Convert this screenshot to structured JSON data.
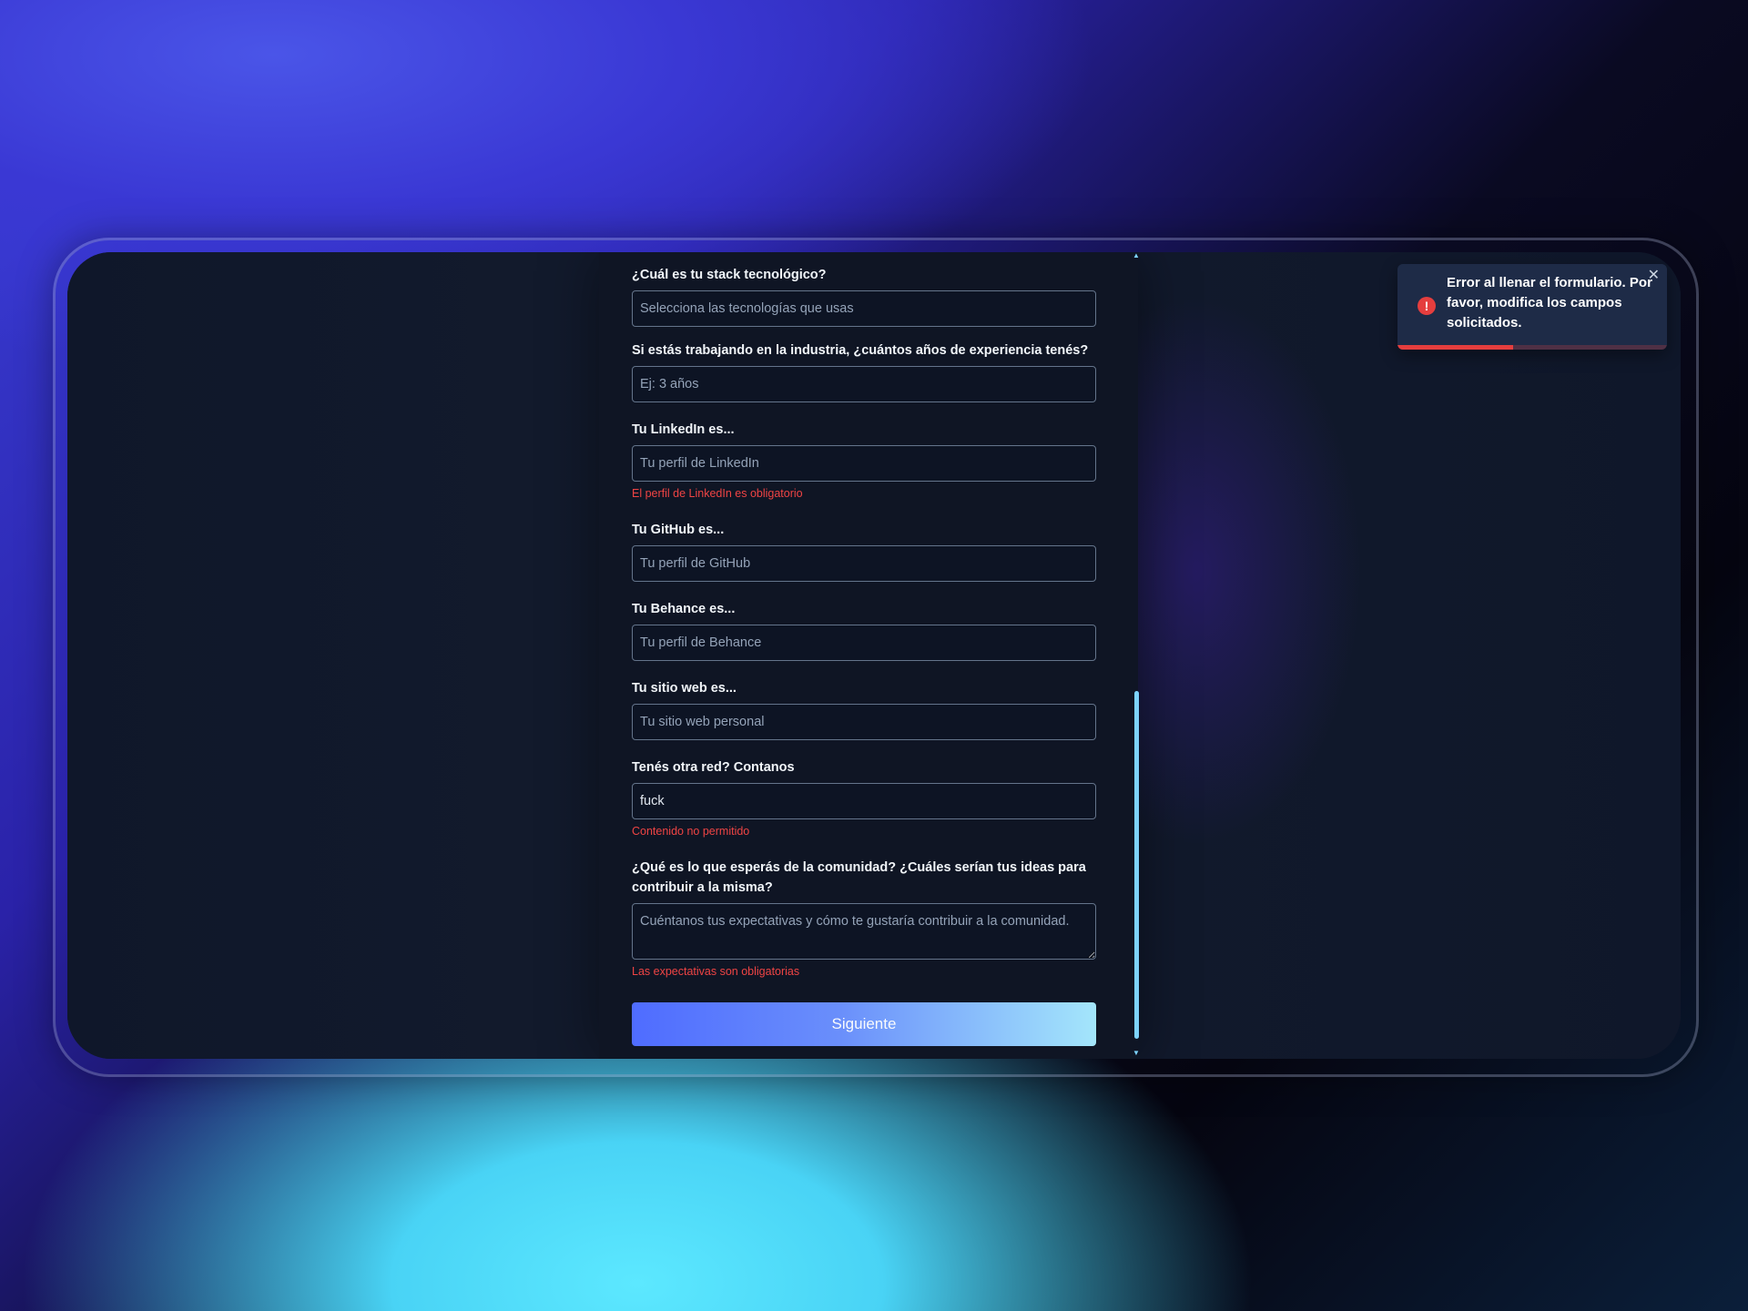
{
  "form": {
    "stack": {
      "label": "¿Cuál es tu stack tecnológico?",
      "placeholder": "Selecciona las tecnologías que usas"
    },
    "experience": {
      "label": "Si estás trabajando en la industria, ¿cuántos años de experiencia tenés?",
      "placeholder": "Ej: 3 años"
    },
    "linkedin": {
      "label": "Tu LinkedIn es...",
      "placeholder": "Tu perfil de LinkedIn",
      "error": "El perfil de LinkedIn es obligatorio"
    },
    "github": {
      "label": "Tu GitHub es...",
      "placeholder": "Tu perfil de GitHub"
    },
    "behance": {
      "label": "Tu Behance es...",
      "placeholder": "Tu perfil de Behance"
    },
    "website": {
      "label": "Tu sitio web es...",
      "placeholder": "Tu sitio web personal"
    },
    "other_network": {
      "label": "Tenés otra red? Contanos",
      "value": "fuck",
      "error": "Contenido no permitido"
    },
    "expectations": {
      "label": "¿Qué es lo que esperás de la comunidad? ¿Cuáles serían tus ideas para contribuir a la misma?",
      "placeholder": "Cuéntanos tus expectativas y cómo te gustaría contribuir a la comunidad.",
      "error": "Las expectativas son obligatorias"
    },
    "submit_label": "Siguiente"
  },
  "toast": {
    "message": "Error al llenar el formulario. Por favor, modifica los campos solicitados.",
    "icon": "alert-circle-icon",
    "close_symbol": "✕",
    "progress": 0.43
  },
  "colors": {
    "error": "#ef4444",
    "accent_start": "#4f6cff",
    "accent_end": "#a4e6fb",
    "scrollbar": "#7dd3fc"
  }
}
